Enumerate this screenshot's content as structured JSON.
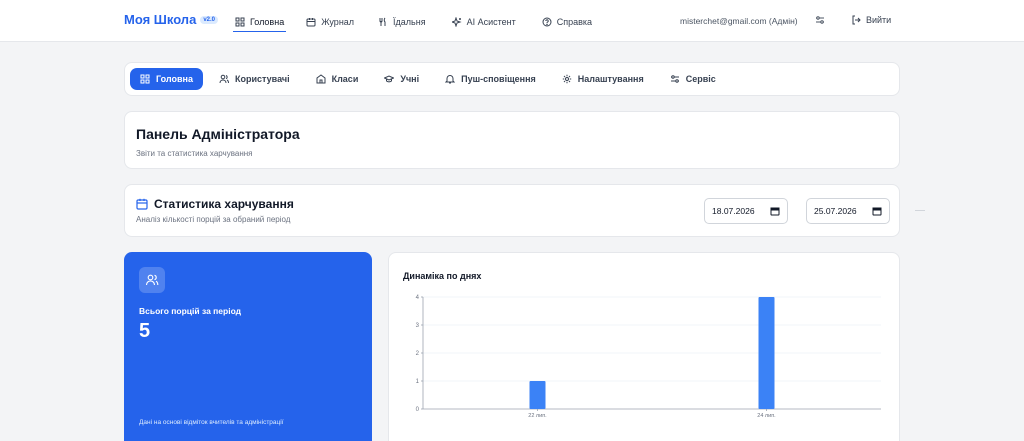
{
  "header": {
    "brand": "Моя Школа",
    "version": "v2.0",
    "nav": [
      {
        "label": "Головна",
        "icon": "grid-icon",
        "active": true
      },
      {
        "label": "Журнал",
        "icon": "calendar-icon"
      },
      {
        "label": "Їдальня",
        "icon": "utensils-icon"
      },
      {
        "label": "AI Асистент",
        "icon": "sparkles-icon"
      },
      {
        "label": "Справка",
        "icon": "help-circle-icon"
      }
    ],
    "user": "misterchet@gmail.com (Адмін)",
    "logout": "Вийти"
  },
  "tabs": [
    {
      "label": "Головна",
      "icon": "grid-icon",
      "active": true
    },
    {
      "label": "Користувачі",
      "icon": "users-icon"
    },
    {
      "label": "Класи",
      "icon": "school-icon"
    },
    {
      "label": "Учні",
      "icon": "graduation-cap-icon"
    },
    {
      "label": "Пуш-сповіщення",
      "icon": "bell-icon"
    },
    {
      "label": "Налаштування",
      "icon": "gear-icon"
    },
    {
      "label": "Сервіс",
      "icon": "sliders-icon"
    }
  ],
  "panel": {
    "title": "Панель Адміністратора",
    "subtitle": "Звіти та статистика харчування"
  },
  "stats": {
    "title": "Статистика харчування",
    "subtitle": "Аналіз кількості порцій за обраний період",
    "date_from": "18.07.2026",
    "date_to": "25.07.2026"
  },
  "summary": {
    "label": "Всього порцій за період",
    "value": "5",
    "footnote": "Дані на основі відміток вчителів та адміністрації"
  },
  "chart_data": {
    "type": "bar",
    "title": "Динаміка по днях",
    "categories": [
      "22 лип.",
      "24 лип."
    ],
    "values": [
      1,
      4
    ],
    "ylim": [
      0,
      4
    ],
    "yticks": [
      "0",
      "1",
      "2",
      "3",
      "4"
    ],
    "color": "#3b82f6",
    "grid": true
  }
}
